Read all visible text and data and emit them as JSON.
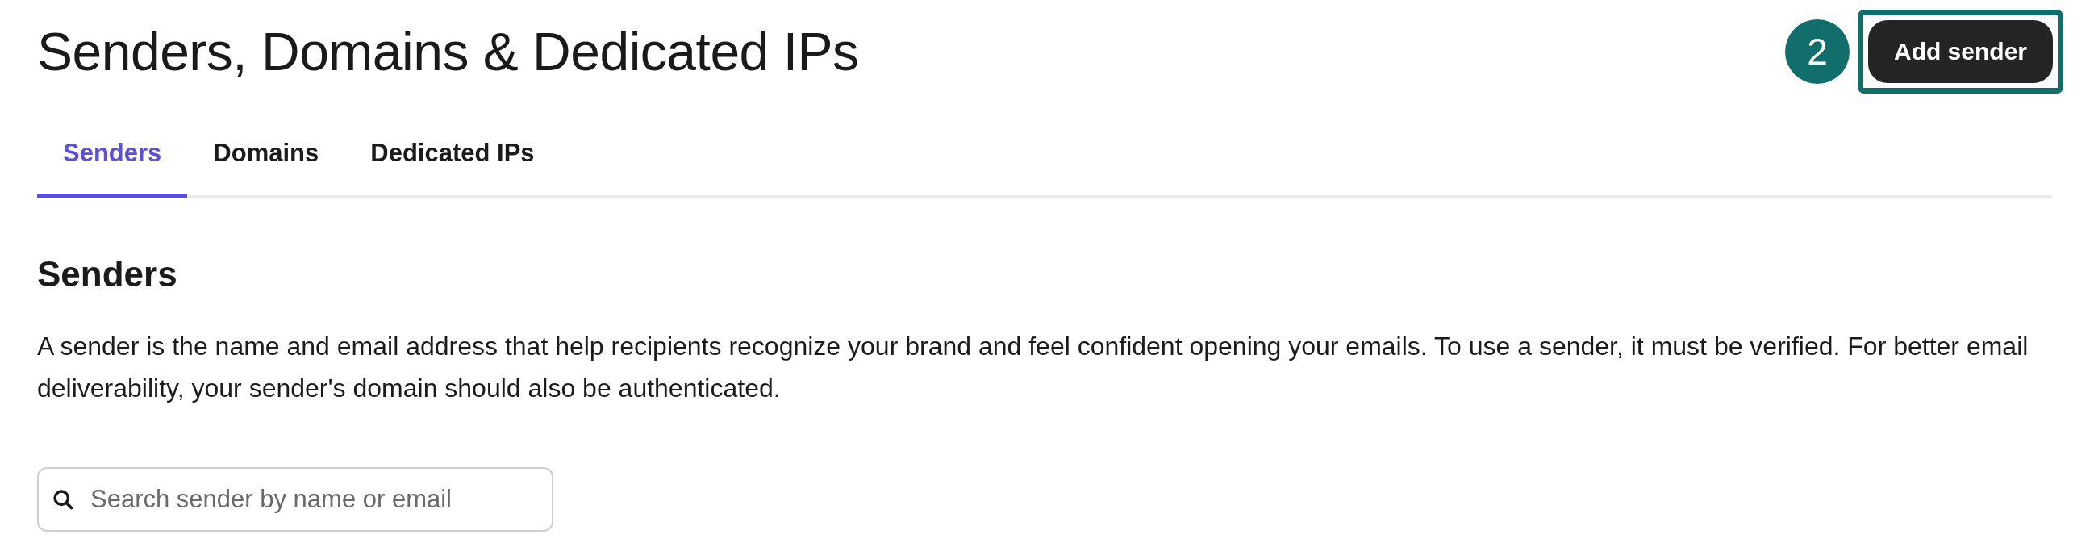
{
  "page_title": "Senders, Domains & Dedicated IPs",
  "step_badge": "2",
  "add_button": "Add sender",
  "tabs": [
    {
      "label": "Senders",
      "selected": true
    },
    {
      "label": "Domains",
      "selected": false
    },
    {
      "label": "Dedicated IPs",
      "selected": false
    }
  ],
  "section": {
    "heading": "Senders",
    "description": "A sender is the name and email address that help recipients recognize your brand and feel confident opening your emails. To use a sender, it must be verified. For better email deliverability, your sender's domain should also be authenticated."
  },
  "search": {
    "placeholder": "Search sender by name or email"
  }
}
